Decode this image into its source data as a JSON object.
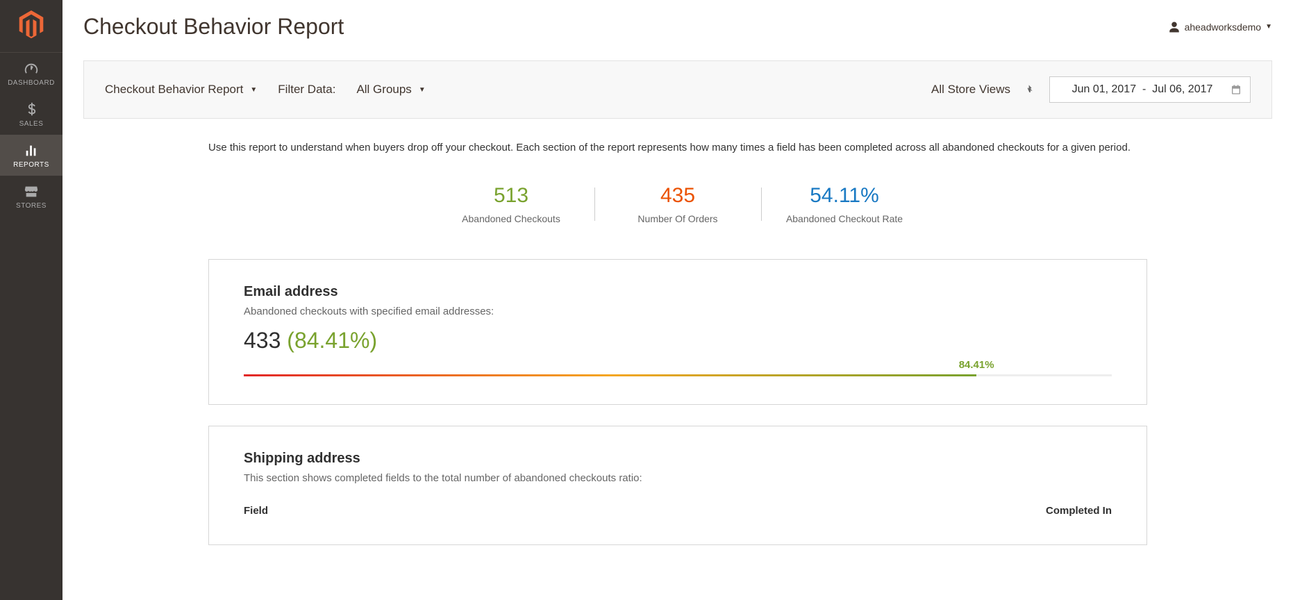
{
  "sidebar": {
    "items": [
      {
        "label": "DASHBOARD"
      },
      {
        "label": "SALES"
      },
      {
        "label": "REPORTS"
      },
      {
        "label": "STORES"
      }
    ]
  },
  "header": {
    "title": "Checkout Behavior Report",
    "user": "aheadworksdemo"
  },
  "filters": {
    "report_type": "Checkout Behavior Report",
    "filter_label": "Filter Data:",
    "group": "All Groups",
    "scope": "All Store Views",
    "date_from": "Jun 01, 2017",
    "date_to": "Jul 06, 2017"
  },
  "description": "Use this report to understand when buyers drop off your checkout. Each section of the report represents how many times a field has been completed across all abandoned checkouts for a given period.",
  "stats": {
    "abandoned_checkouts": {
      "value": "513",
      "label": "Abandoned Checkouts"
    },
    "number_of_orders": {
      "value": "435",
      "label": "Number Of Orders"
    },
    "abandoned_rate": {
      "value": "54.11%",
      "label": "Abandoned Checkout Rate"
    }
  },
  "email_section": {
    "title": "Email address",
    "subtitle": "Abandoned checkouts with specified email addresses:",
    "count": "433",
    "percent": "(84.41%)",
    "progress_label": "84.41%",
    "progress_width": "84.41%"
  },
  "shipping_section": {
    "title": "Shipping address",
    "subtitle": "This section shows completed fields to the total number of abandoned checkouts ratio:",
    "col1": "Field",
    "col2": "Completed In"
  }
}
